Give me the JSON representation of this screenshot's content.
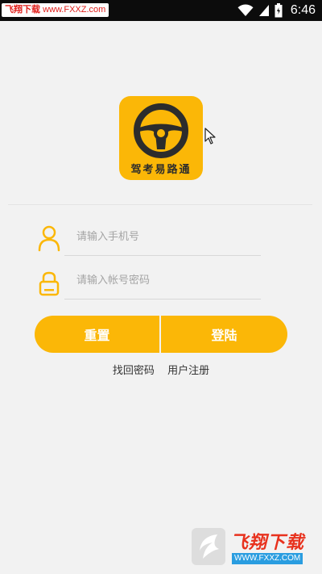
{
  "status_bar": {
    "watermark_brand": "飞翔下载",
    "watermark_url": "www.FXXZ.com",
    "time": "6:46",
    "icons": [
      "wifi-icon",
      "signal-icon",
      "battery-icon"
    ]
  },
  "logo": {
    "app_name": "驾考易路通",
    "icon": "steering-wheel-icon"
  },
  "form": {
    "phone_placeholder": "请输入手机号",
    "password_placeholder": "请输入帐号密码"
  },
  "buttons": {
    "reset": "重置",
    "login": "登陆"
  },
  "links": {
    "forgot_password": "找回密码",
    "register": "用户注册"
  },
  "watermark_bottom": {
    "name": "飞翔下载",
    "url": "WWW.FXXZ.COM"
  },
  "colors": {
    "accent": "#fbb707",
    "status_bar": "#0c0c0c",
    "background": "#f2f2f2"
  }
}
